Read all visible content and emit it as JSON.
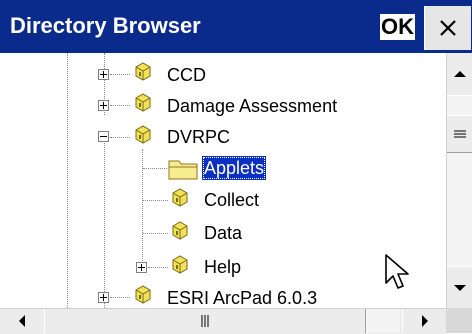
{
  "window": {
    "title": "Directory Browser",
    "ok_label": "OK",
    "close_label": "✕"
  },
  "tree": {
    "items": [
      {
        "label": "CCD",
        "expander": "plus",
        "icon": "database-folder-icon"
      },
      {
        "label": "Damage Assessment",
        "expander": "plus",
        "icon": "database-folder-icon"
      },
      {
        "label": "DVRPC",
        "expander": "minus",
        "icon": "database-folder-icon"
      },
      {
        "label": "Applets",
        "expander": "none",
        "icon": "folder-icon",
        "selected": true
      },
      {
        "label": "Collect",
        "expander": "none",
        "icon": "database-folder-icon"
      },
      {
        "label": "Data",
        "expander": "none",
        "icon": "database-folder-icon"
      },
      {
        "label": "Help",
        "expander": "plus",
        "icon": "database-folder-icon"
      },
      {
        "label": "ESRI ArcPad 6.0.3",
        "expander": "plus",
        "icon": "database-folder-icon"
      }
    ]
  },
  "colors": {
    "title_bar": "#0a2a8c",
    "selection": "#0b2fbf",
    "scrollbar": "#ececec"
  }
}
